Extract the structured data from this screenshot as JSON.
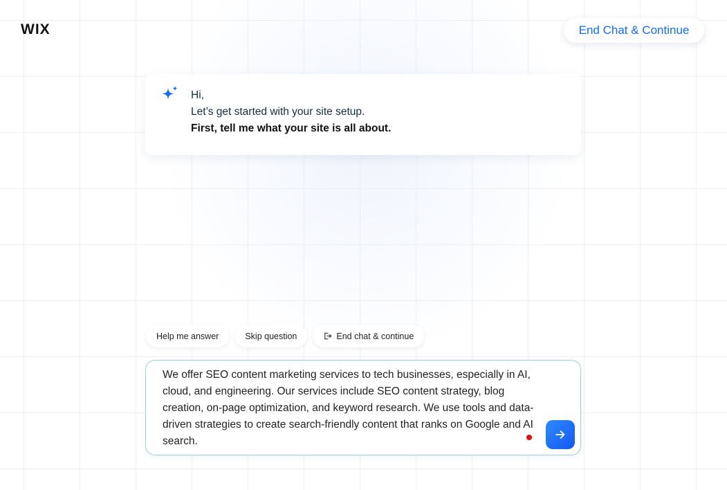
{
  "header": {
    "logo": "WIX",
    "end_chat_label": "End Chat & Continue"
  },
  "assistant_message": {
    "greeting": "Hi,",
    "line2": "Let’s get started with your site setup.",
    "line3": "First, tell me what your site is all about."
  },
  "quick_actions": {
    "help_label": "Help me answer",
    "skip_label": "Skip question",
    "end_label": "End chat & continue"
  },
  "composer": {
    "value": "We offer SEO content marketing services to tech businesses, especially in AI, cloud, and engineering. Our services include SEO content strategy, blog creation, on-page optimization, and keyword research. We use tools and data-driven strategies to create search-friendly content that ranks on Google and AI search."
  },
  "icons": {
    "assistant": "sparkle-icon",
    "end_chat": "exit-icon",
    "send": "arrow-right-icon"
  },
  "colors": {
    "accent": "#116dff",
    "send_gradient_start": "#2e8bff",
    "send_gradient_end": "#1357f0",
    "input_border": "#9fd0d8",
    "dot": "#e01010"
  }
}
